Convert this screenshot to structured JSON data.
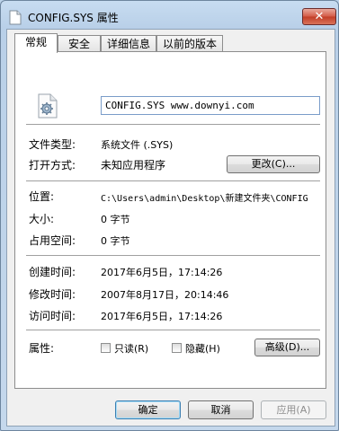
{
  "window": {
    "title": "CONFIG.SYS 属性",
    "close_glyph": "✕"
  },
  "tabs": [
    {
      "label": "常规"
    },
    {
      "label": "安全"
    },
    {
      "label": "详细信息"
    },
    {
      "label": "以前的版本"
    }
  ],
  "general": {
    "file_name": "CONFIG.SYS www.downyi.com",
    "file_type_label": "文件类型:",
    "file_type_value": "系统文件 (.SYS)",
    "opens_with_label": "打开方式:",
    "opens_with_value": "未知应用程序",
    "change_button": "更改(C)...",
    "location_label": "位置:",
    "location_value": "C:\\Users\\admin\\Desktop\\新建文件夹\\CONFIG",
    "size_label": "大小:",
    "size_value": "0 字节",
    "size_on_disk_label": "占用空间:",
    "size_on_disk_value": "0 字节",
    "created_label": "创建时间:",
    "created_value": "2017年6月5日，17:14:26",
    "modified_label": "修改时间:",
    "modified_value": "2007年8月17日，20:14:46",
    "accessed_label": "访问时间:",
    "accessed_value": "2017年6月5日，17:14:26",
    "attributes_label": "属性:",
    "readonly_label": "只读(R)",
    "readonly_checked": false,
    "hidden_label": "隐藏(H)",
    "hidden_checked": false,
    "advanced_button": "高级(D)..."
  },
  "footer": {
    "ok": "确定",
    "cancel": "取消",
    "apply": "应用(A)"
  },
  "icons": {
    "window_icon": "document-icon",
    "file_icon": "system-file-gear-icon"
  }
}
